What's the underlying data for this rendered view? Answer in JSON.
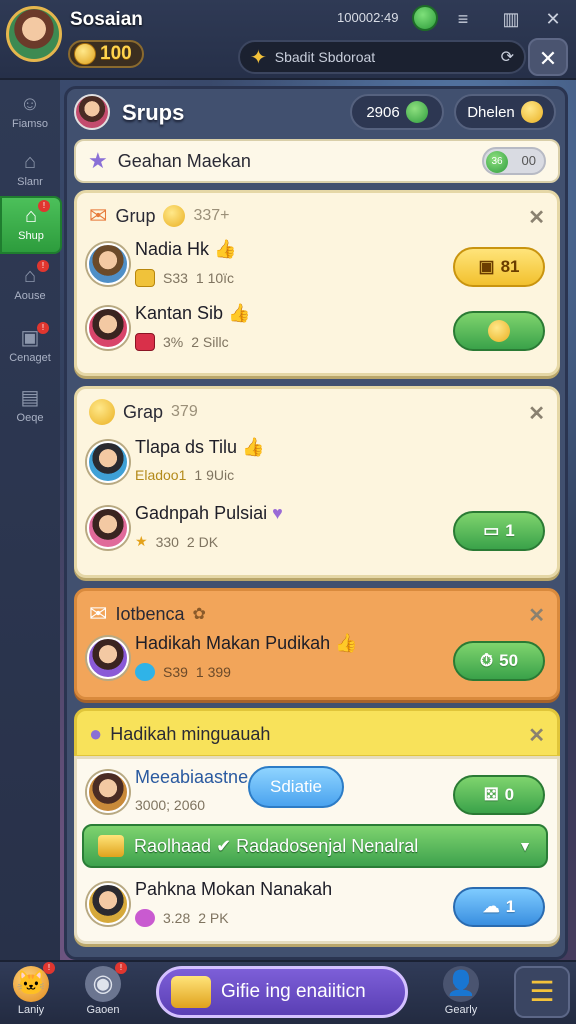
{
  "header": {
    "player_name": "Sosaian",
    "coins": "100",
    "clock": "100002:49"
  },
  "search": {
    "placeholder": "Sbadit Sbdoroat"
  },
  "sidebar": {
    "items": [
      {
        "label": "Fiamso",
        "icon": "people-icon"
      },
      {
        "label": "Slanr",
        "icon": "home-icon"
      },
      {
        "label": "Shup",
        "icon": "shop-icon"
      },
      {
        "label": "Aouse",
        "icon": "house-icon"
      },
      {
        "label": "Cenaget",
        "icon": "gift-icon"
      },
      {
        "label": "Oeqe",
        "icon": "chart-icon"
      }
    ]
  },
  "panel": {
    "title": "Srups",
    "pill1": "2906",
    "pill2": "Dhelen"
  },
  "filter": {
    "label": "Geahan Maekan",
    "toggle": "00",
    "knob": "36"
  },
  "groups": [
    {
      "title": "Grup",
      "count": "337+",
      "rows": [
        {
          "name": "Nadia Hk",
          "sub1": "S33",
          "sub2": "1 10ïc",
          "btn": "81"
        },
        {
          "name": "Kantan Sib",
          "sub1": "3%",
          "sub2": "2 Sillc",
          "btn": ""
        }
      ]
    },
    {
      "title": "Grap",
      "count": "379",
      "rows": [
        {
          "name": "Tlapa ds Tilu",
          "sub1": "Eladoo1",
          "sub2": "1 9Uic",
          "btn": ""
        },
        {
          "name": "Gadnpah Pulsiai",
          "sub1": "330",
          "sub2": "2 DK",
          "btn": "1"
        }
      ]
    },
    {
      "title": "Iotbenca",
      "rows": [
        {
          "name": "Hadikah Makan Pudikah",
          "sub1": "S39",
          "sub2": "1 399",
          "btn": "50"
        }
      ]
    },
    {
      "title": "Hadikah minguauah",
      "rows": [
        {
          "name": "Meeabiaastne",
          "sub1": "3000; 2060",
          "btn": "0"
        },
        {
          "name": "Pahkna Mokan Nanakah",
          "sub1": "3.28",
          "sub2": "2 PK",
          "btn": "1"
        }
      ]
    }
  ],
  "bubble": "Sdiatie",
  "ribbon": "Raolhaad ✔ Radadosenjal Nenalral",
  "bottom": {
    "left1": "Laniy",
    "left2": "Gaoen",
    "big": "Gifie ing enaiiticn",
    "right": "Gearly"
  }
}
